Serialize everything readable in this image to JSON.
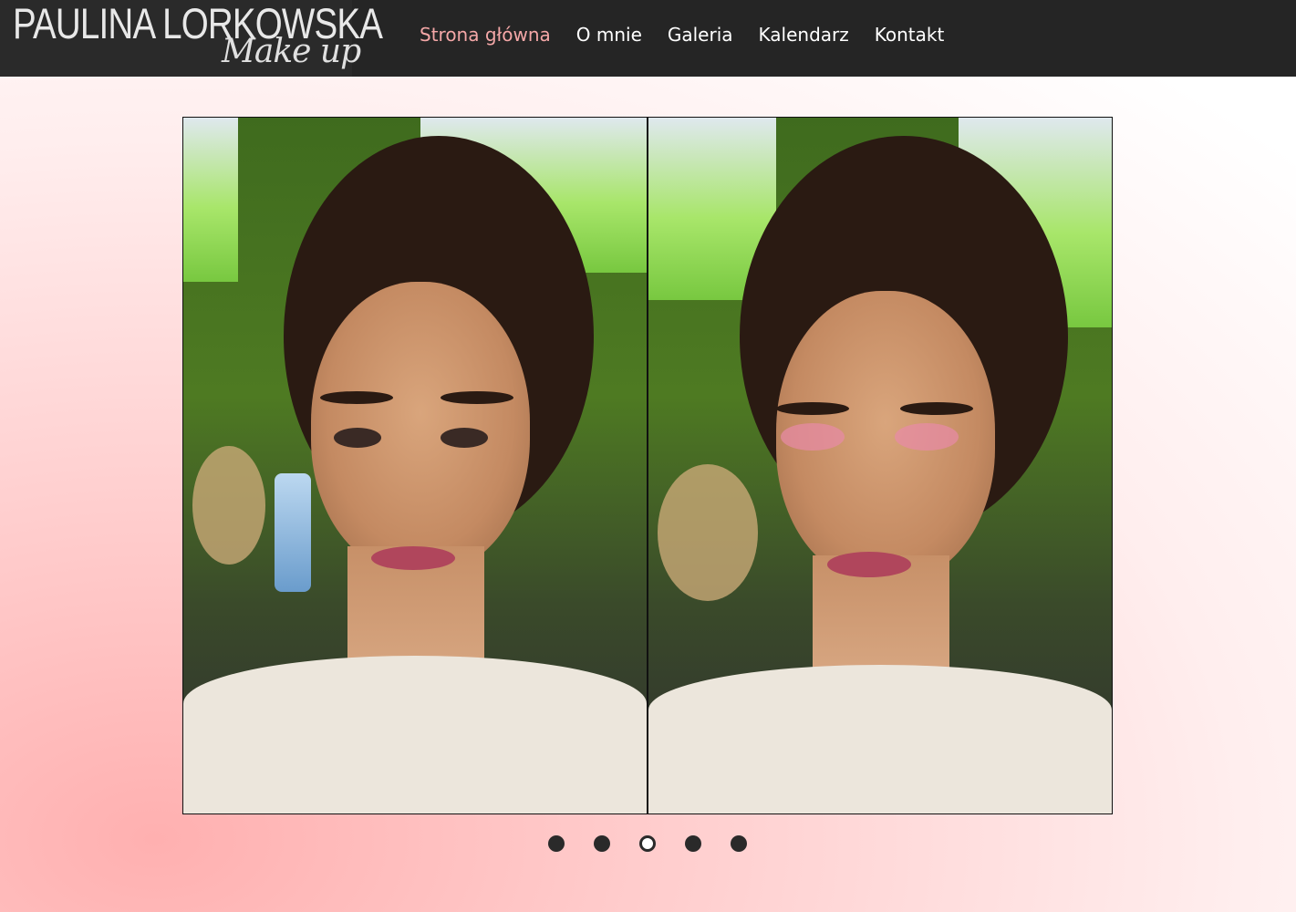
{
  "header": {
    "logo_name": "PAULINA LORKOWSKA",
    "logo_script": "Make up"
  },
  "nav": {
    "items": [
      {
        "label": "Strona główna",
        "active": true
      },
      {
        "label": "O mnie",
        "active": false
      },
      {
        "label": "Galeria",
        "active": false
      },
      {
        "label": "Kalendarz",
        "active": false
      },
      {
        "label": "Kontakt",
        "active": false
      }
    ]
  },
  "slider": {
    "slide_count": 5,
    "active_slide": 3
  },
  "colors": {
    "nav_active": "#f4a7a7",
    "nav_text": "#ffffff",
    "topbar": "#252525"
  }
}
